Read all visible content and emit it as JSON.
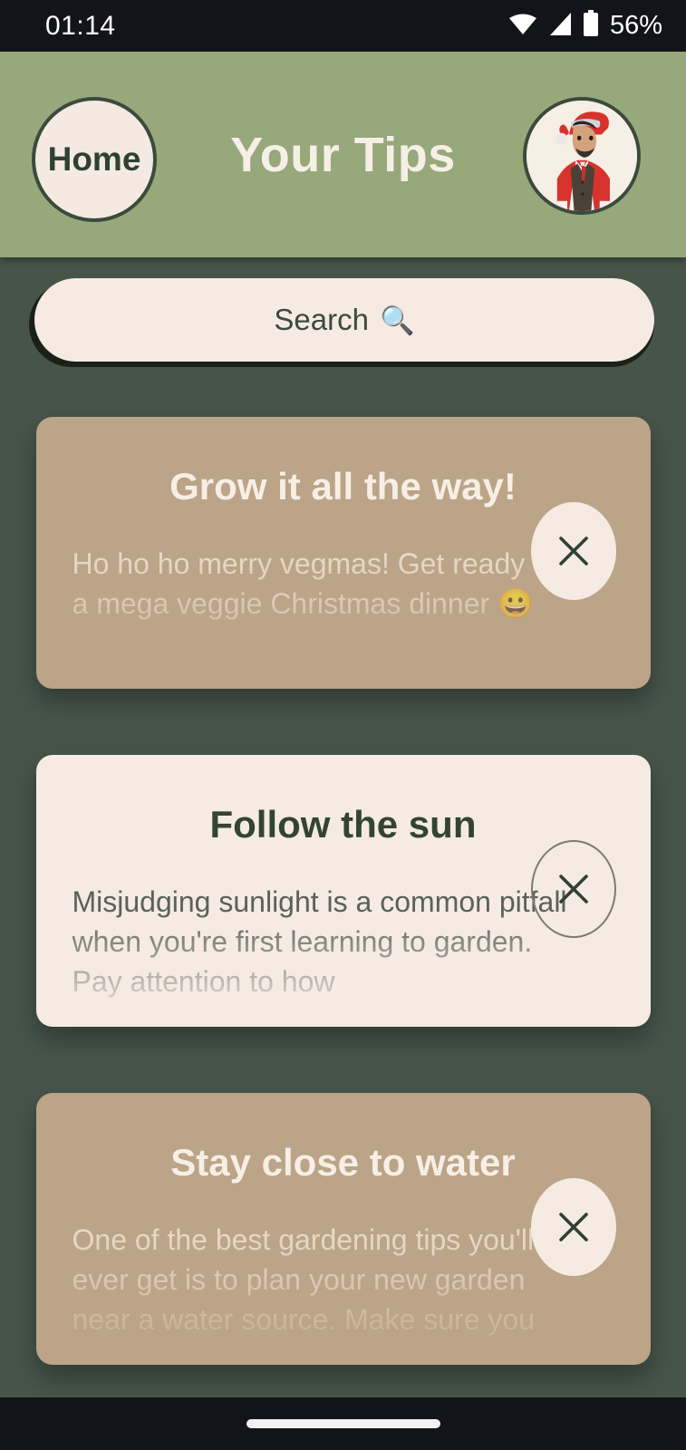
{
  "status_bar": {
    "time": "01:14",
    "battery_text": "56%",
    "icons": [
      "wifi-icon",
      "cellular-signal-icon",
      "battery-icon"
    ]
  },
  "header": {
    "home_label": "Home",
    "title": "Your Tips",
    "avatar_alt": "user-avatar-santa-suit",
    "background_color": "#97a87a",
    "border_color": "#3b4a3d"
  },
  "search": {
    "placeholder": "Search",
    "icon": "🔍"
  },
  "theme": {
    "page_background": "#46544a",
    "card_tan": "#bba487",
    "card_cream": "#f5ebe3",
    "text_cream": "#f7efe6",
    "text_dark_green": "#33452f"
  },
  "tips": [
    {
      "title": "Grow it all the way!",
      "body": "Ho ho ho merry vegmas! Get ready for a mega veggie Christmas dinner 😀",
      "style": "tan",
      "close_style": "filled",
      "close_label": "×"
    },
    {
      "title": "Follow the sun",
      "body": "Misjudging sunlight is a common pitfall when you're first learning to garden. Pay attention to how",
      "style": "cream",
      "close_style": "outline",
      "close_label": "×"
    },
    {
      "title": "Stay close to water",
      "body": "One of the best gardening tips you'll ever get is to plan your new garden near a water source. Make sure you",
      "style": "tan",
      "close_style": "filled",
      "close_label": "×"
    }
  ]
}
